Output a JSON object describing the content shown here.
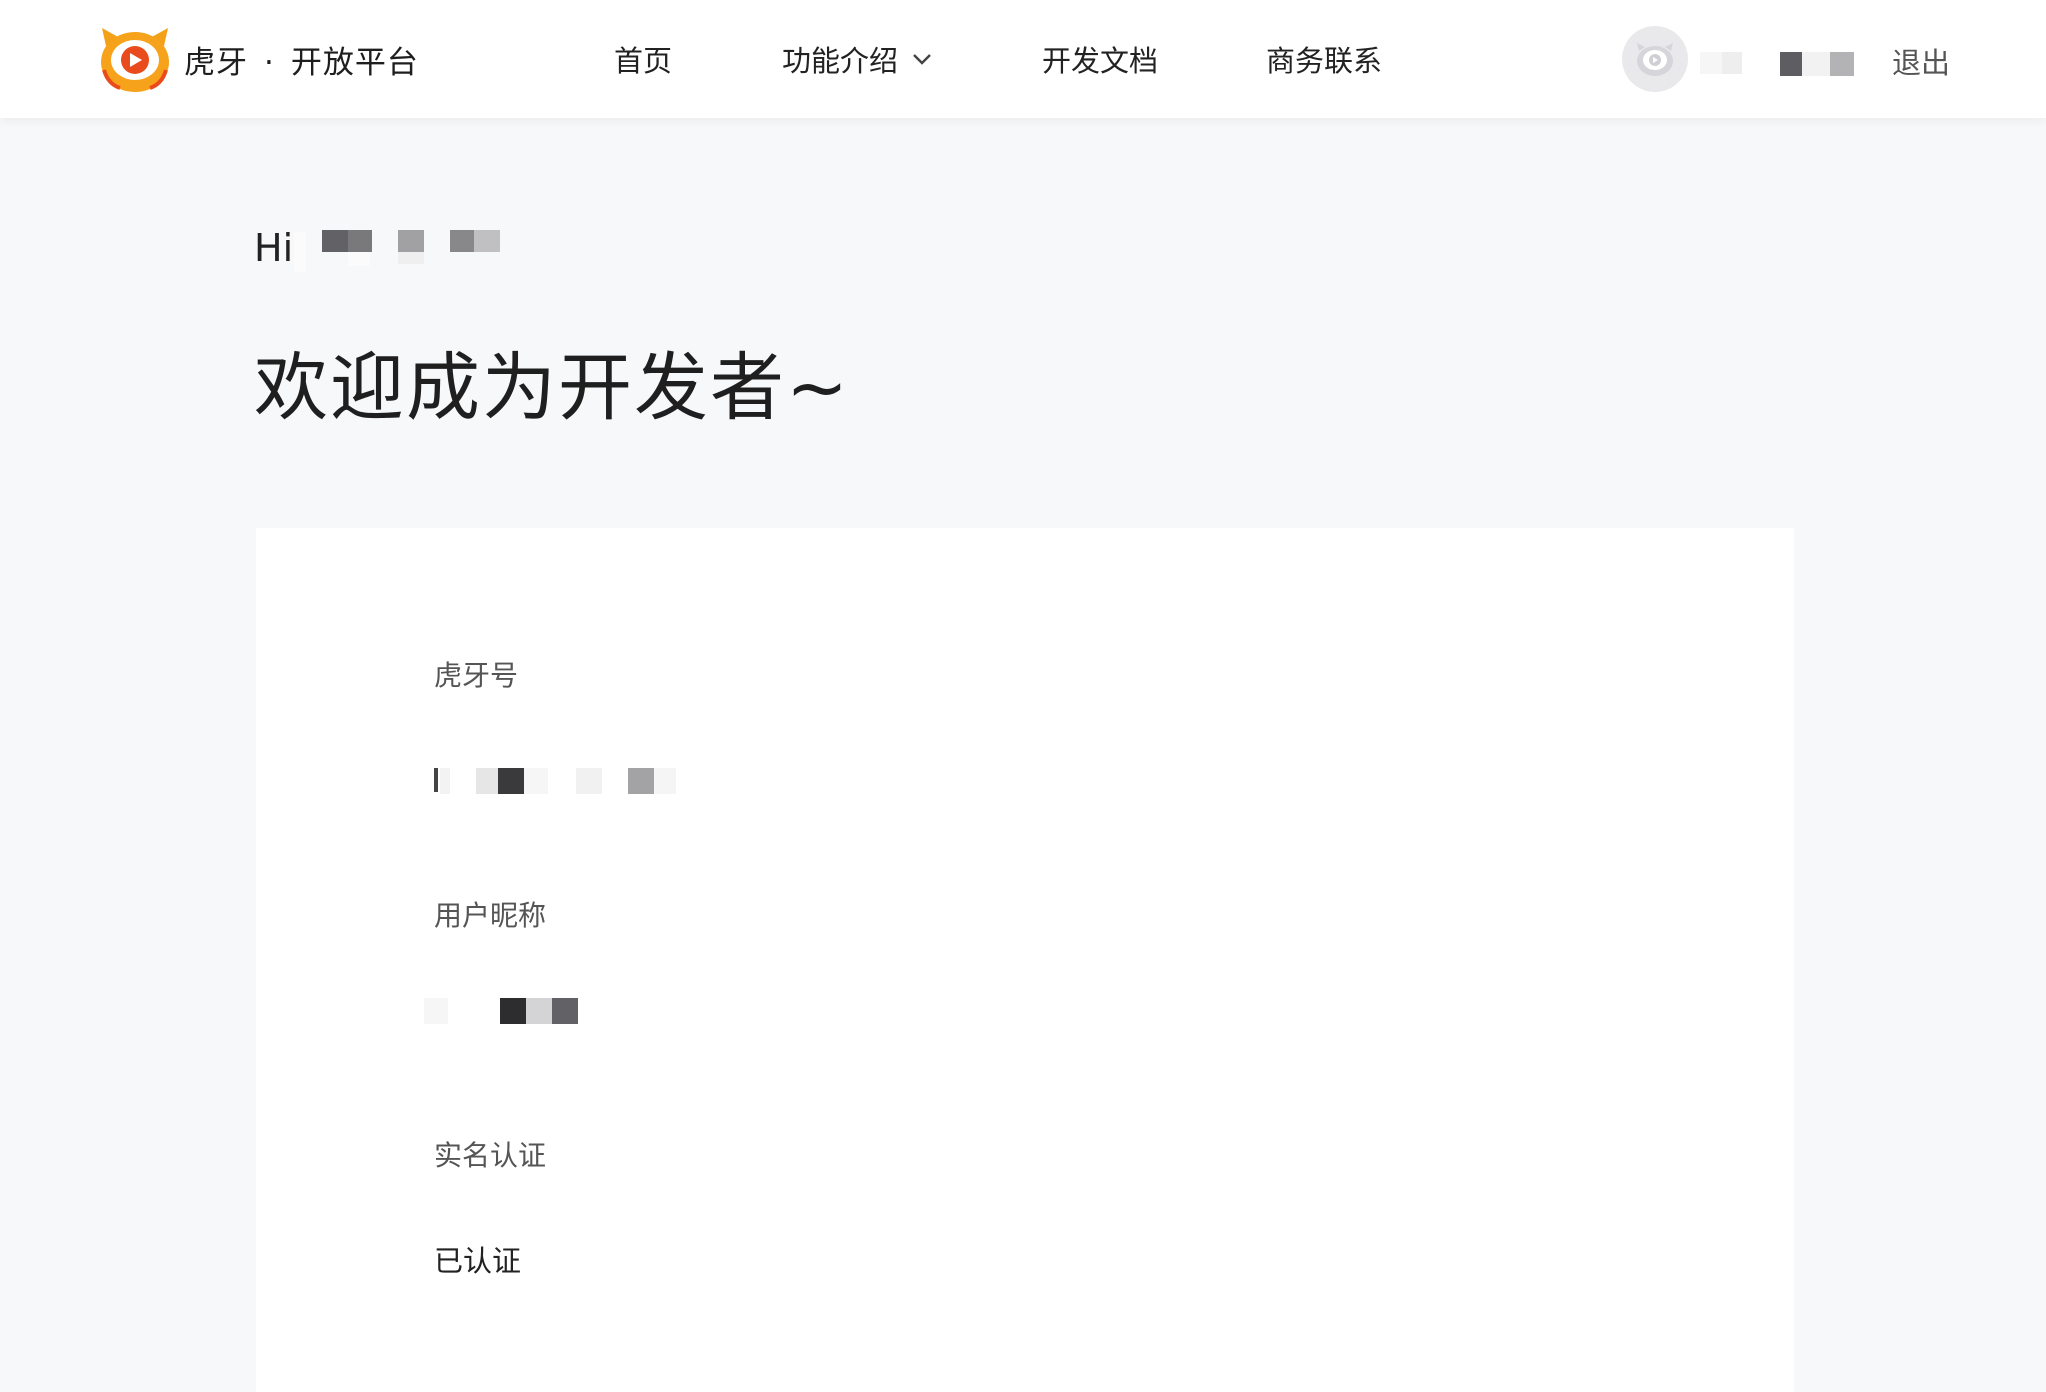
{
  "header": {
    "brand_name": "虎牙",
    "brand_sep": "·",
    "brand_suffix": "开放平台",
    "nav": [
      {
        "label": "首页"
      },
      {
        "label": "功能介绍",
        "has_dropdown": true
      },
      {
        "label": "开发文档"
      },
      {
        "label": "商务联系"
      }
    ],
    "user_name": "",
    "logout_label": "退出"
  },
  "main": {
    "greeting": "Hi,",
    "greeting_name": "",
    "welcome": "欢迎成为开发者~"
  },
  "profile": {
    "fields": [
      {
        "label": "虎牙号",
        "value": ""
      },
      {
        "label": "用户昵称",
        "value": ""
      },
      {
        "label": "实名认证",
        "value": "已认证"
      }
    ]
  },
  "colors": {
    "brand_orange": "#f7a21b",
    "brand_red": "#e94b1c",
    "page_bg": "#f7f8fa",
    "card_bg": "#ffffff"
  }
}
